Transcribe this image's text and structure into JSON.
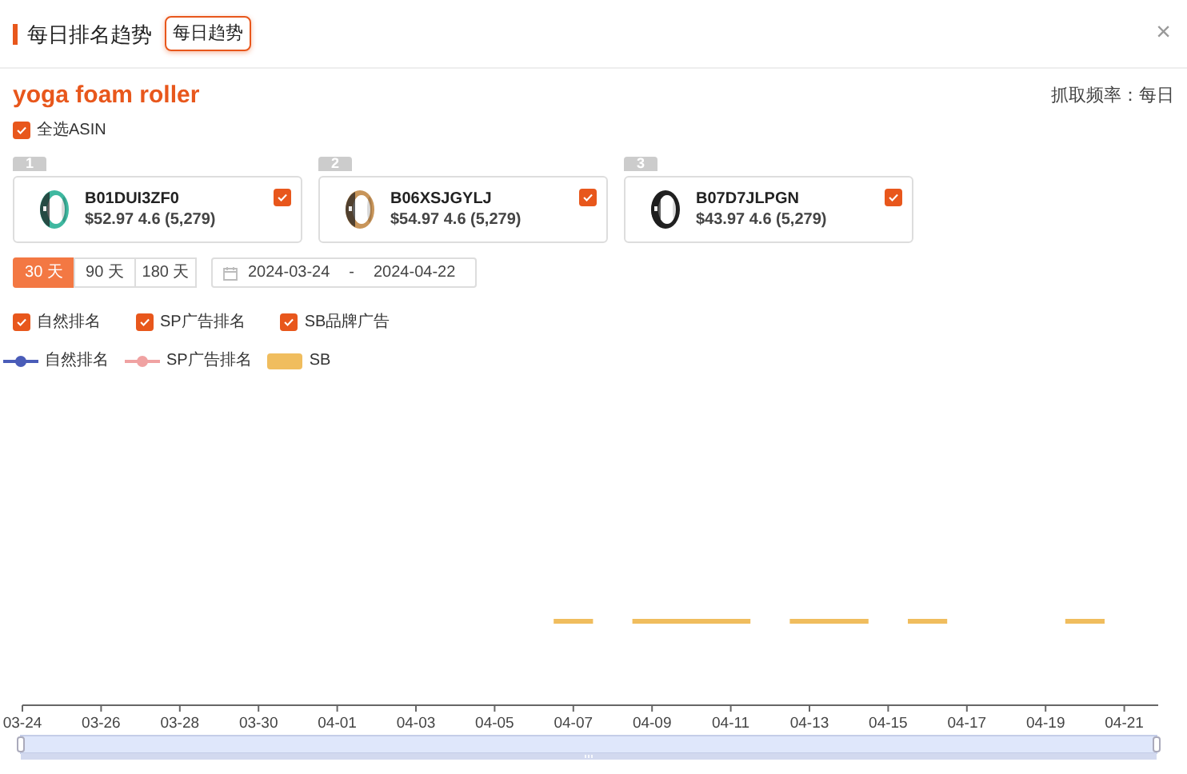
{
  "header": {
    "title": "每日排名趋势",
    "tag": "每日趋势",
    "close": "×"
  },
  "keyword": {
    "title": "yoga foam roller",
    "frequency": "抓取频率：每日"
  },
  "select_all": {
    "label": "全选ASIN",
    "checked": true
  },
  "products": [
    {
      "rank": "1",
      "asin": "B01DUI3ZF0",
      "details": "$52.97 4.6 (5,279)",
      "checked": true
    },
    {
      "rank": "2",
      "asin": "B06XSJGYLJ",
      "details": "$54.97 4.6 (5,279)",
      "checked": true
    },
    {
      "rank": "3",
      "asin": "B07D7JLPGN",
      "details": "$43.97 4.6 (5,279)",
      "checked": true
    }
  ],
  "ranges": [
    {
      "label": "30 天",
      "selected": true
    },
    {
      "label": "90 天",
      "selected": false
    },
    {
      "label": "180 天",
      "selected": false
    }
  ],
  "date_range": {
    "start": "2024-03-24",
    "separator": "-",
    "end": "2024-04-22"
  },
  "series_filters": [
    {
      "label": "自然排名",
      "checked": true
    },
    {
      "label": "SP广告排名",
      "checked": true
    },
    {
      "label": "SB品牌广告",
      "checked": true
    }
  ],
  "chart": {
    "legend": [
      {
        "label": "自然排名",
        "kind": "line",
        "color": "#4a5cb8"
      },
      {
        "label": "SP广告排名",
        "kind": "line",
        "color": "#f0a2a2"
      },
      {
        "label": "SB",
        "kind": "bar",
        "color": "#f0bd5e"
      }
    ],
    "zoom_slider": {
      "level": 1
    },
    "x_labels": [
      "03-24",
      "03-26",
      "03-28",
      "03-30",
      "04-01",
      "04-03",
      "04-05",
      "04-07",
      "04-09",
      "04-11",
      "04-13",
      "04-15",
      "04-17",
      "04-19",
      "04-21"
    ]
  }
}
